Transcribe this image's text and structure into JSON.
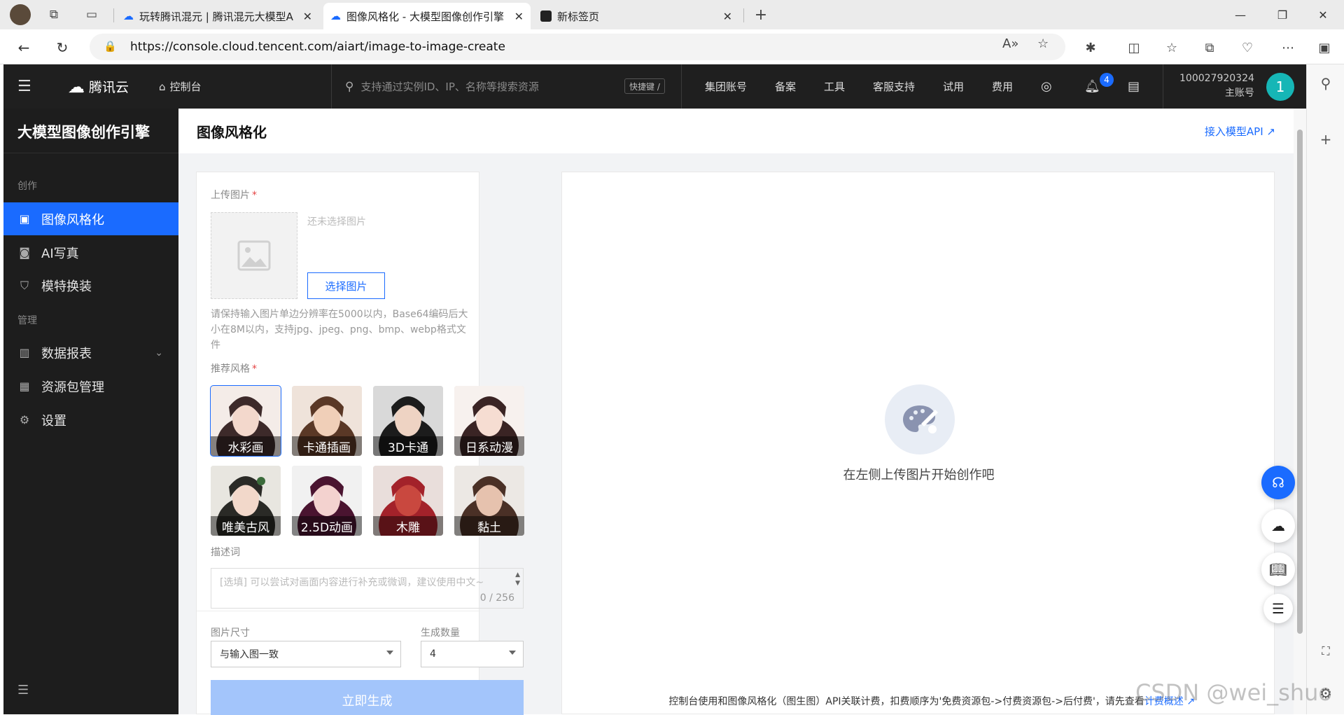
{
  "browser": {
    "tabs": [
      {
        "title": "玩转腾讯混元 | 腾讯混元大模型AI",
        "active": false
      },
      {
        "title": "图像风格化 - 大模型图像创作引擎",
        "active": true
      },
      {
        "title": "新标签页",
        "active": false
      }
    ],
    "url": "https://console.cloud.tencent.com/aiart/image-to-image-create"
  },
  "topnav": {
    "brand": "腾讯云",
    "console": "控制台",
    "search_placeholder": "支持通过实例ID、IP、名称等搜索资源",
    "shortcut": "快捷键 /",
    "links": [
      "集团账号",
      "备案",
      "工具",
      "客服支持",
      "试用",
      "费用"
    ],
    "notifications": "4",
    "account_id": "100027920324",
    "account_type": "主账号",
    "avatar_letter": "1"
  },
  "sidebar": {
    "title": "大模型图像创作引擎",
    "groups": [
      {
        "label": "创作",
        "items": [
          "图像风格化",
          "AI写真",
          "模特换装"
        ]
      },
      {
        "label": "管理",
        "items": [
          "数据报表",
          "资源包管理",
          "设置"
        ]
      }
    ]
  },
  "page": {
    "title": "图像风格化",
    "api_link": "接入模型API"
  },
  "form": {
    "upload_label": "上传图片",
    "no_image": "还未选择图片",
    "pick_button": "选择图片",
    "hint": "请保持输入图片单边分辨率在5000以内，Base64编码后大小在8M以内，支持jpg、jpeg、png、bmp、webp格式文件",
    "style_label": "推荐风格",
    "styles": [
      "水彩画",
      "卡通插画",
      "3D卡通",
      "日系动漫",
      "唯美古风",
      "2.5D动画",
      "木雕",
      "黏土"
    ],
    "selected_style": "水彩画",
    "desc_label": "描述词",
    "desc_placeholder": "[选填] 可以尝试对画面内容进行补充或微调，建议使用中文~",
    "desc_count": "0 / 256",
    "size_label": "图片尺寸",
    "size_value": "与输入图一致",
    "count_label": "生成数量",
    "count_value": "4",
    "generate_button": "立即生成"
  },
  "result": {
    "empty_text": "在左侧上传图片开始创作吧",
    "footnote": "控制台使用和图像风格化（图生图）API关联计费，扣费顺序为'免费资源包->付费资源包->后付费'，请先查看",
    "footnote_link": "计费概述"
  },
  "watermark": "CSDN @wei_shuo",
  "colors": {
    "accent": "#1a6bff",
    "topnav": "#1f1f1f",
    "sidebar": "#1d1d1d",
    "avatar": "#16b6b6"
  }
}
